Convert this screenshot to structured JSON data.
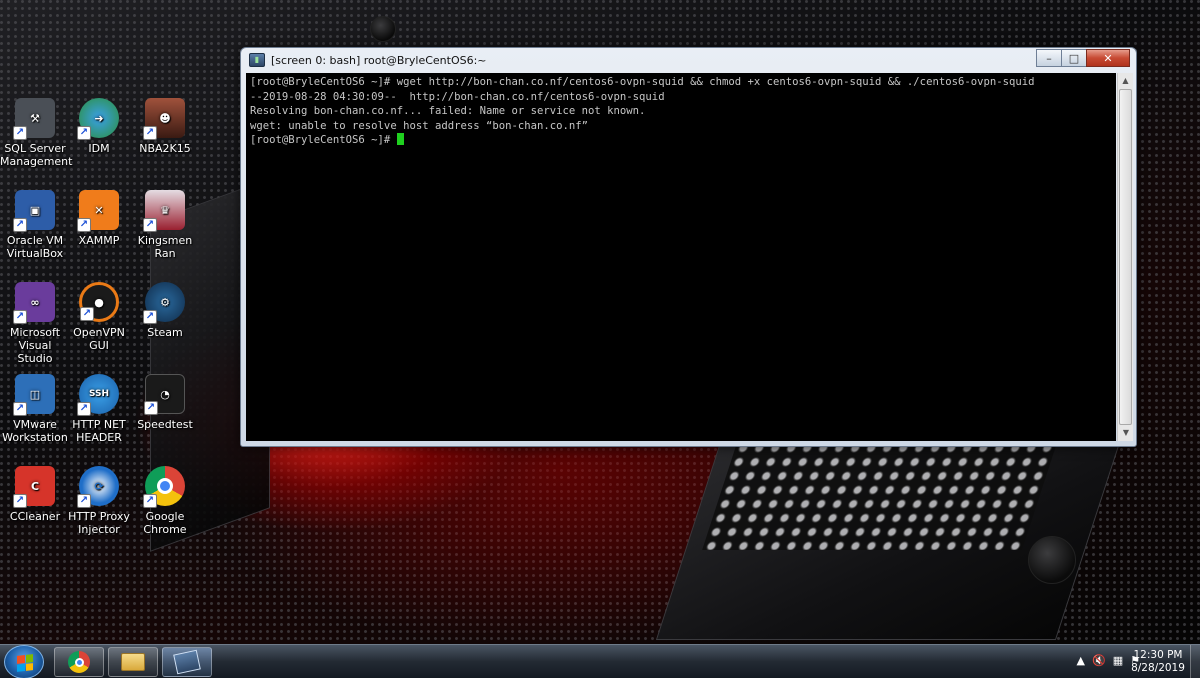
{
  "desktop": {
    "icons": [
      {
        "label": "SQL Server Management",
        "icon": "sql-server-icon",
        "color": "#5a5f66"
      },
      {
        "label": "IDM",
        "icon": "idm-icon",
        "color": "#2b8f3c"
      },
      {
        "label": "NBA2K15",
        "icon": "nba2k15-icon",
        "color": "#7b2c1f"
      },
      {
        "label": "Oracle VM VirtualBox",
        "icon": "virtualbox-icon",
        "color": "#2d5da8"
      },
      {
        "label": "XAMMP",
        "icon": "xampp-icon",
        "color": "#f07c1b"
      },
      {
        "label": "Kingsmen Ran",
        "icon": "kingsmen-ran-icon",
        "color": "#c9c1c8"
      },
      {
        "label": "Microsoft Visual Studio",
        "icon": "visual-studio-icon",
        "color": "#6a3c9c"
      },
      {
        "label": "OpenVPN GUI",
        "icon": "openvpn-icon",
        "color": "#ea7a16"
      },
      {
        "label": "Steam",
        "icon": "steam-icon",
        "color": "#1b4a7a"
      },
      {
        "label": "VMware Workstation",
        "icon": "vmware-icon",
        "color": "#2d6fb8"
      },
      {
        "label": "HTTP NET HEADER",
        "icon": "ssh-icon",
        "color": "#1e78c8"
      },
      {
        "label": "Speedtest",
        "icon": "speedtest-icon",
        "color": "#1a1a1a"
      },
      {
        "label": "CCleaner",
        "icon": "ccleaner-icon",
        "color": "#d6342a"
      },
      {
        "label": "HTTP Proxy Injector",
        "icon": "http-proxy-injector-icon",
        "color": "#1f6ec8"
      },
      {
        "label": "Google Chrome",
        "icon": "chrome-icon",
        "color": "#e0e0e0"
      }
    ]
  },
  "window": {
    "title": "[screen 0: bash] root@BryleCentOS6:~",
    "buttons": {
      "minimize": "–",
      "maximize": "□",
      "close": "✕"
    },
    "lines": [
      "[root@BryleCentOS6 ~]# wget http://bon-chan.co.nf/centos6-ovpn-squid && chmod +x centos6-ovpn-squid && ./centos6-ovpn-squid",
      "--2019-08-28 04:30:09--  http://bon-chan.co.nf/centos6-ovpn-squid",
      "Resolving bon-chan.co.nf... failed: Name or service not known.",
      "wget: unable to resolve host address “bon-chan.co.nf”"
    ],
    "prompt": "[root@BryleCentOS6 ~]# ",
    "cursor_color": "#1fd01f"
  },
  "taskbar": {
    "pinned": [
      {
        "name": "chrome-icon"
      },
      {
        "name": "explorer-icon"
      },
      {
        "name": "putty-icon",
        "active": true
      }
    ],
    "tray_icons": [
      "show-hidden-icons-arrow",
      "volume-muted-icon",
      "network-icon",
      "action-center-flag-icon"
    ],
    "time": "12:30 PM",
    "date": "8/28/2019"
  }
}
